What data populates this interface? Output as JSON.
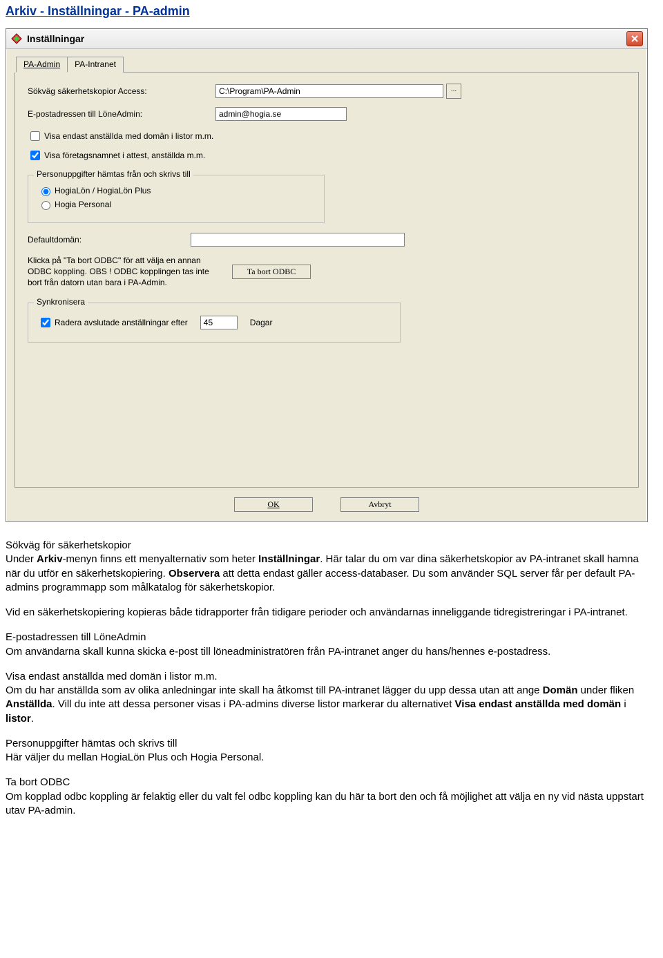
{
  "breadcrumb": "Arkiv - Inställningar - PA-admin",
  "window": {
    "title": "Inställningar",
    "tabs": {
      "pa_admin": "PA-Admin",
      "pa_intranet": "PA-Intranet"
    },
    "fields": {
      "path_label": "Sökväg säkerhetskopior Access:",
      "path_value": "C:\\Program\\PA-Admin",
      "browse_dots": "...",
      "email_label": "E-postadressen till LöneAdmin:",
      "email_value": "admin@hogia.se",
      "chk_domain": "Visa endast anställda med domän i listor m.m.",
      "chk_company": "Visa företagsnamnet i attest, anställda m.m.",
      "group_person_title": "Personuppgifter hämtas från och skrivs till",
      "radio_hlon": "HogiaLön / HogiaLön Plus",
      "radio_hpers": "Hogia Personal",
      "default_domain_label": "Defaultdomän:",
      "default_domain_value": "",
      "odbc_text": "Klicka på \"Ta bort ODBC\" för att välja en annan ODBC koppling. OBS ! ODBC kopplingen tas inte bort från datorn utan bara i PA-Admin.",
      "odbc_button": "Ta bort ODBC",
      "sync_legend": "Synkronisera",
      "sync_chk": "Radera avslutade anställningar efter",
      "sync_days_value": "45",
      "sync_days_unit": "Dagar"
    },
    "buttons": {
      "ok": "OK",
      "cancel": "Avbryt"
    }
  },
  "article": {
    "h1": "Sökväg för säkerhetskopior",
    "p1a": "Under ",
    "p1_arkiv": "Arkiv",
    "p1b": "-menyn finns ett menyalternativ som heter ",
    "p1_inst": "Inställningar",
    "p1c": ". Här talar du om var dina säkerhetskopior av PA-intranet skall hamna när du utför en säkerhetskopiering. ",
    "p1_obs": "Observera",
    "p1d": " att detta endast gäller access-databaser. Du som använder SQL server får per default PA-admins programmapp som målkatalog för säkerhetskopior.",
    "p2": "Vid en säkerhetskopiering kopieras både tidrapporter från tidigare perioder och användarnas inneliggande tidregistreringar i PA-intranet.",
    "h2": "E-postadressen till LöneAdmin",
    "p3": "Om användarna skall kunna skicka e-post till löneadministratören från PA-intranet anger du hans/hennes e-postadress.",
    "h3": "Visa endast anställda med domän i listor m.m.",
    "p4a": "Om du har anställda som av olika anledningar inte skall ha åtkomst till PA-intranet lägger du upp dessa utan att ange ",
    "p4_domain": "Domän",
    "p4b": " under fliken ",
    "p4_anst": "Anställda",
    "p4c": ". Vill du inte att dessa personer visas i PA-admins diverse listor markerar du alternativet ",
    "p4_opt": "Visa endast anställda med domän",
    "p4d": " i ",
    "p4_listor": "listor",
    "p4e": ".",
    "h4": "Personuppgifter hämtas och skrivs till",
    "p5": "Här väljer du mellan HogiaLön Plus och Hogia Personal.",
    "h5": "Ta bort ODBC",
    "p6": "Om kopplad odbc koppling är felaktig eller du valt fel odbc koppling kan du här ta bort den och få möjlighet att välja en ny vid nästa uppstart utav PA-admin."
  }
}
